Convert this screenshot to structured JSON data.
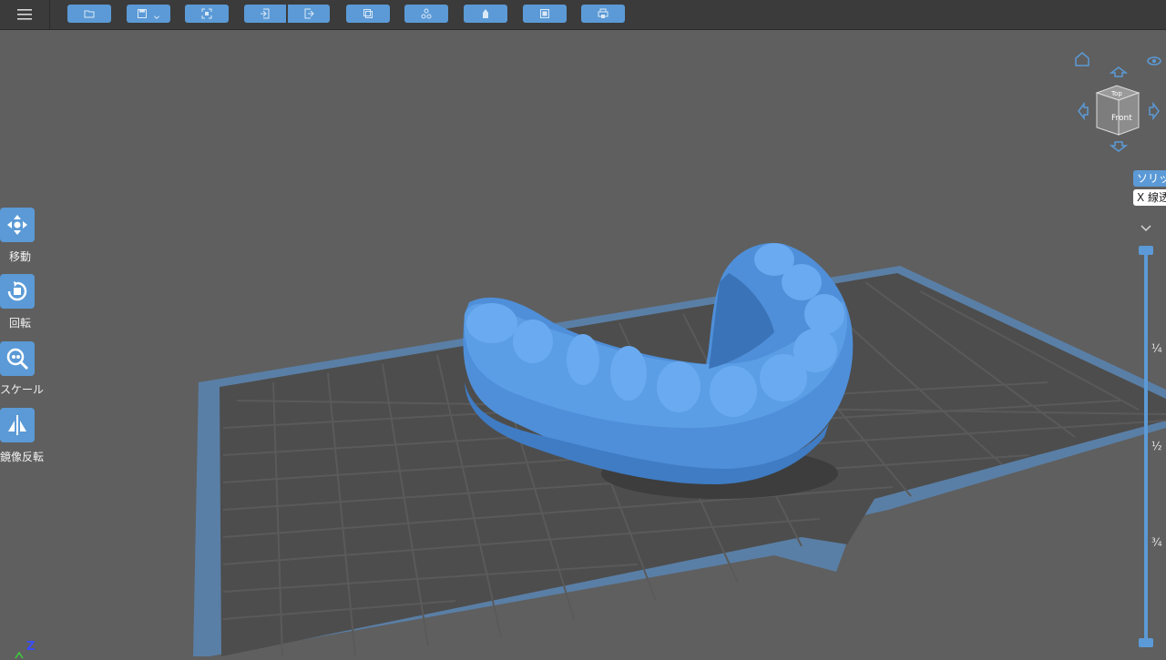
{
  "toolbar": {
    "buttons": [
      {
        "name": "open-file-button",
        "icon": "folder-icon"
      },
      {
        "name": "save-button",
        "icon": "save-icon",
        "has_dropdown": true
      },
      {
        "name": "capture-button",
        "icon": "scan-icon"
      },
      {
        "name": "import-button",
        "icon": "import-icon"
      },
      {
        "name": "export-button",
        "icon": "export-icon"
      },
      {
        "name": "copy-button",
        "icon": "copy-icon"
      },
      {
        "name": "arrange-button",
        "icon": "molecule-icon"
      },
      {
        "name": "support-button",
        "icon": "support-icon"
      },
      {
        "name": "slice-button",
        "icon": "slice-icon"
      },
      {
        "name": "print-button",
        "icon": "print-icon"
      }
    ]
  },
  "tools": [
    {
      "label": "移動",
      "icon": "move-icon"
    },
    {
      "label": "回転",
      "icon": "rotate-icon"
    },
    {
      "label": "スケール",
      "icon": "scale-icon"
    },
    {
      "label": "鏡像反転",
      "icon": "mirror-icon"
    }
  ],
  "viewcube": {
    "top_label": "Top",
    "front_label": "Front"
  },
  "view_modes": {
    "solid": "ソリッ",
    "wireframe": "X 線透"
  },
  "slider": {
    "marks": [
      "¼",
      "½",
      "¾"
    ]
  },
  "axes": {
    "z_label": "Z"
  },
  "colors": {
    "accent": "#5b9ad6",
    "model": "#4f8fd9",
    "background": "#5f5f5f",
    "toolbar": "#3b3b3b"
  }
}
